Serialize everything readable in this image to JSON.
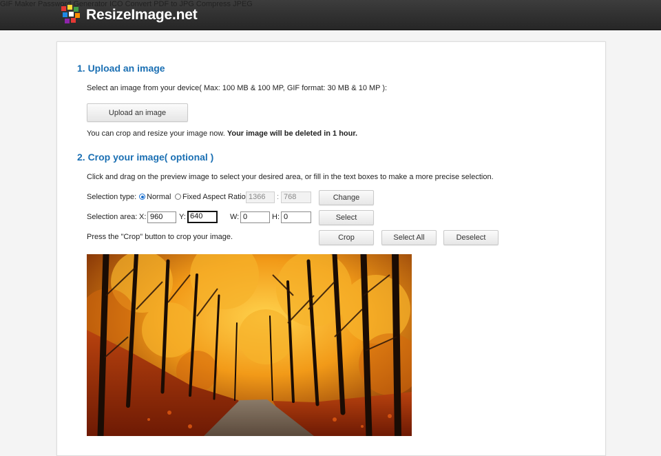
{
  "brand": {
    "name": "ResizeImage.net",
    "logo_colors": [
      "#e53935",
      "#fdd835",
      "#43a047",
      "#1e88e5",
      "#fb8c00",
      "#8e24aa",
      "#ffffff"
    ]
  },
  "nav": [
    {
      "label": "GIF Maker"
    },
    {
      "label": "Password Generator"
    },
    {
      "label": "ICO Convert"
    },
    {
      "label": "PDF to JPG"
    },
    {
      "label": "Compress JPEG"
    }
  ],
  "upload": {
    "heading": "1. Upload an image",
    "instructions": "Select an image from your device( Max: 100 MB & 100 MP, GIF format: 30 MB & 10 MP ):",
    "button_label": "Upload an image",
    "note": "You can crop and resize your image now. ",
    "note_bold": "Your image will be deleted in 1 hour."
  },
  "crop": {
    "heading": "2. Crop your image( optional )",
    "instructions": "Click and drag on the preview image to select your desired area, or fill in the text boxes to make a more precise selection.",
    "selection_type_label": "Selection type:",
    "normal_label": "Normal",
    "fixed_label": "Fixed Aspect Ratio",
    "selected_type": "Normal",
    "ratio_w": "1366",
    "ratio_sep": ":",
    "ratio_h": "768",
    "change_label": "Change",
    "selection_area_label": "Selection area:",
    "x_label": "X:",
    "x_value": "960",
    "y_label": "Y:",
    "y_value": "640",
    "w_label": "W:",
    "w_value": "0",
    "h_label": "H:",
    "h_value": "0",
    "select_label": "Select",
    "crop_hint": "Press the \"Crop\" button to crop your image.",
    "crop_label": "Crop",
    "select_all_label": "Select All",
    "deselect_label": "Deselect"
  },
  "colors": {
    "accent": "#1a6fb3",
    "header_bg": "#2e2e2e"
  }
}
